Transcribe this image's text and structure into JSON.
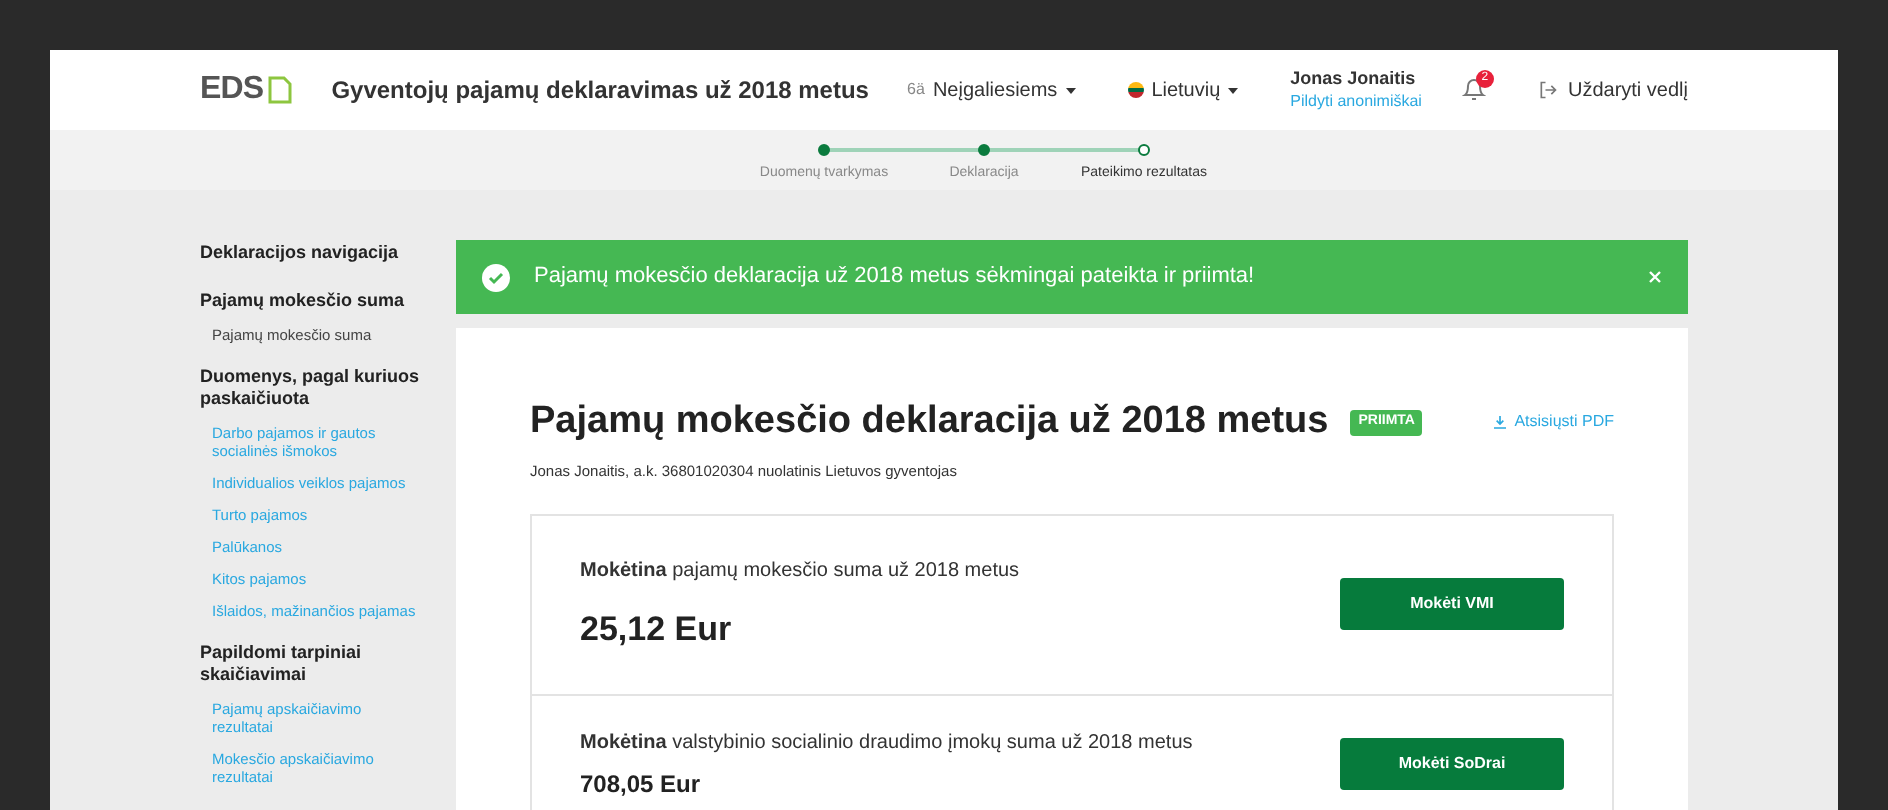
{
  "header": {
    "logo": "EDS",
    "title": "Gyventojų pajamų deklaravimas už 2018 metus",
    "accessibility": {
      "icon_text": "6ä",
      "label": "Neįgaliesiems"
    },
    "language": "Lietuvių",
    "user": {
      "name": "Jonas Jonaitis",
      "link": "Pildyti anonimiškai"
    },
    "notifications": {
      "count": "2"
    },
    "close": "Uždaryti vedlį"
  },
  "steps": [
    {
      "label": "Duomenų tvarkymas",
      "completed": true,
      "selected": false
    },
    {
      "label": "Deklaracija",
      "completed": true,
      "selected": false
    },
    {
      "label": "Pateikimo rezultatas",
      "completed": false,
      "selected": true
    }
  ],
  "sidebar": {
    "title": "Deklaracijos navigacija",
    "sections": [
      {
        "title": "Pajamų mokesčio suma",
        "items": [
          {
            "label": "Pajamų mokesčio suma",
            "kind": "plain"
          }
        ]
      },
      {
        "title": "Duomenys, pagal kuriuos paskaičiuota",
        "items": [
          {
            "label": "Darbo pajamos ir gautos socialinės išmokos",
            "kind": "link"
          },
          {
            "label": "Individualios veiklos pajamos",
            "kind": "link"
          },
          {
            "label": "Turto pajamos",
            "kind": "link"
          },
          {
            "label": "Palūkanos",
            "kind": "link"
          },
          {
            "label": "Kitos pajamos",
            "kind": "link"
          },
          {
            "label": "Išlaidos, mažinančios pajamas",
            "kind": "link"
          }
        ]
      },
      {
        "title": "Papildomi tarpiniai skaičiavimai",
        "items": [
          {
            "label": "Pajamų apskaičiavimo rezultatai",
            "kind": "link"
          },
          {
            "label": "Mokesčio apskaičiavimo rezultatai",
            "kind": "link"
          }
        ]
      }
    ]
  },
  "alert": {
    "message": "Pajamų mokesčio deklaracija už 2018 metus sėkmingai pateikta ir priimta!"
  },
  "declaration": {
    "title": "Pajamų mokesčio deklaracija už 2018 metus",
    "status": "PRIIMTA",
    "download": "Atsisiųsti PDF",
    "subtitle": "Jonas Jonaitis, a.k. 36801020304 nuolatinis Lietuvos gyventojas",
    "payments": [
      {
        "description": "**Mokėtina** pajamų mokesčio suma už 2018 metus",
        "amount": "25,12 Eur",
        "button": "Mokėti VMI",
        "kind": "large"
      },
      {
        "description": "**Mokėtina** valstybinio socialinio draudimo įmokų suma už 2018 metus",
        "amount": "708,05 Eur",
        "button": "Mokėti SoDrai",
        "kind": "small"
      }
    ]
  }
}
